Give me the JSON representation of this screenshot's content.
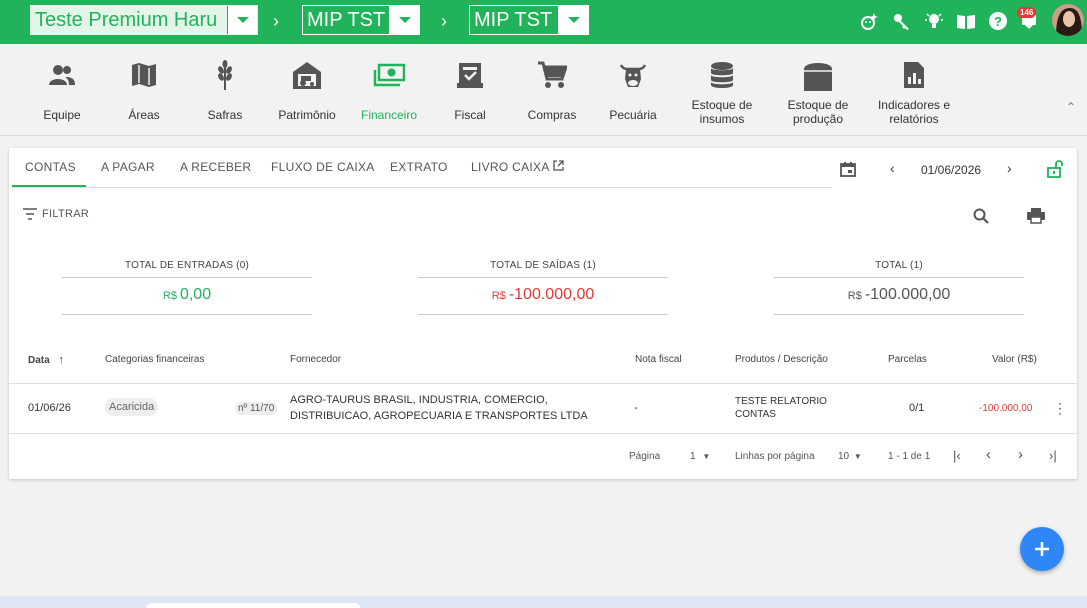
{
  "topbar": {
    "farm": "Teste Premium Haru",
    "crumb1": "MIP TST",
    "crumb2": "MIP TST",
    "notif_count": "146"
  },
  "modules": [
    {
      "label": "Equipe",
      "icon": "people-icon"
    },
    {
      "label": "Áreas",
      "icon": "map-icon"
    },
    {
      "label": "Safras",
      "icon": "wheat-icon"
    },
    {
      "label": "Patrimônio",
      "icon": "barn-tractor-icon"
    },
    {
      "label": "Financeiro",
      "icon": "money-icon"
    },
    {
      "label": "Fiscal",
      "icon": "fiscal-icon"
    },
    {
      "label": "Compras",
      "icon": "cart-icon"
    },
    {
      "label": "Pecuária",
      "icon": "cow-icon"
    },
    {
      "label": "Estoque de insumos",
      "icon": "database-icon"
    },
    {
      "label": "Estoque de produção",
      "icon": "silo-icon"
    },
    {
      "label": "Indicadores e relatórios",
      "icon": "report-icon"
    }
  ],
  "tabs": [
    "CONTAS",
    "A PAGAR",
    "A RECEBER",
    "FLUXO DE CAIXA",
    "EXTRATO",
    "LIVRO CAIXA"
  ],
  "date": "01/06/2026",
  "filter_label": "FILTRAR",
  "totals": {
    "entradas_label": "TOTAL DE ENTRADAS (0)",
    "entradas_cur": "R$",
    "entradas_val": "0,00",
    "saidas_label": "TOTAL DE SAÍDAS (1)",
    "saidas_cur": "R$",
    "saidas_val": "-100.000,00",
    "total_label": "TOTAL (1)",
    "total_cur": "R$",
    "total_val": "-100.000,00"
  },
  "table": {
    "headers": [
      "Data",
      "Categorias financeiras",
      "Fornecedor",
      "Nota fiscal",
      "Produtos / Descrição",
      "Parcelas",
      "Valor (R$)"
    ],
    "rows": [
      {
        "date": "01/06/26",
        "category": "Acaricida",
        "number": "nº 11/70",
        "supplier_line1": "AGRO-TAURUS BRASIL, INDUSTRIA, COMERCIO,",
        "supplier_line2": "DISTRIBUICAO, AGROPECUARIA E TRANSPORTES LTDA",
        "invoice": "-",
        "desc_line1": "TESTE RELATORIO",
        "desc_line2": "CONTAS",
        "installments": "0/1",
        "value": "-100.000,00"
      }
    ]
  },
  "pagination": {
    "page_label": "Página",
    "page": "1",
    "rows_label": "Linhas por página",
    "rows": "10",
    "range": "1 - 1 de 1"
  },
  "colors": {
    "brand": "#21b35a",
    "negative": "#e53935",
    "fab": "#2f86f6"
  }
}
